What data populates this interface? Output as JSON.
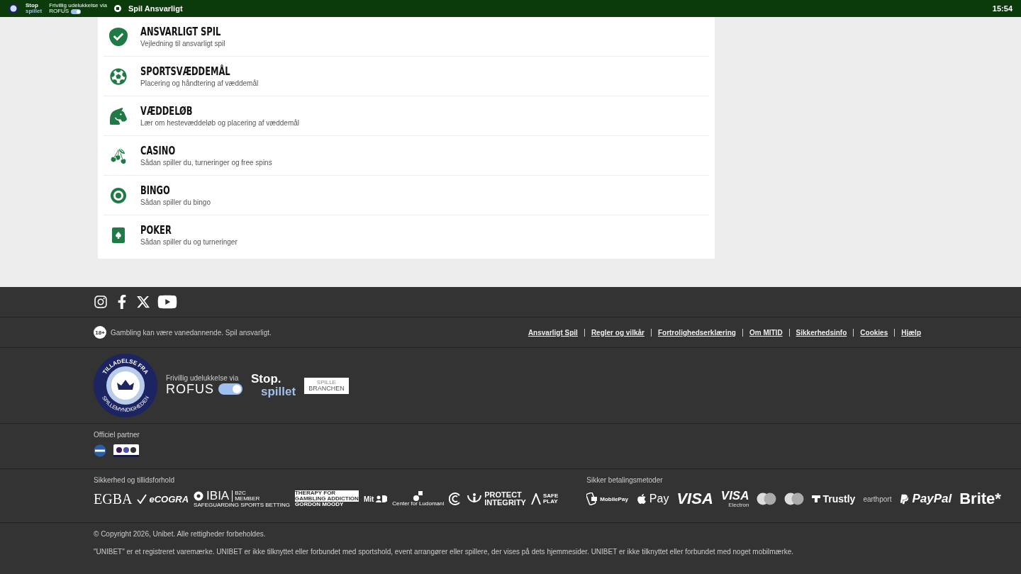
{
  "top_bar": {
    "stop_logo": [
      "Stop",
      "spillet"
    ],
    "rofus_caption": "Frivillig udelukkelse via",
    "rofus_word": "ROFUS",
    "title": "Spil Ansvarligt",
    "time": "15:54"
  },
  "menu": [
    {
      "kind": "shield",
      "title": "ANSVARLIGT SPIL",
      "subtitle": "Vejledning til ansvarligt spil"
    },
    {
      "kind": "ball",
      "title": "SPORTSVÆDDEMÅL",
      "subtitle": "Placering og håndtering af væddemål"
    },
    {
      "kind": "horse",
      "title": "VÆDDELØB",
      "subtitle": "Lær om hestevæddeløb og placering af væddemål"
    },
    {
      "kind": "cherries",
      "title": "CASINO",
      "subtitle": "Sådan spiller du, turneringer og free spins"
    },
    {
      "kind": "bingo",
      "title": "BINGO",
      "subtitle": "Sådan spiller du bingo"
    },
    {
      "kind": "card",
      "title": "POKER",
      "subtitle": "Sådan spiller du og turneringer"
    }
  ],
  "footer": {
    "social": [
      {
        "kind": "instagram"
      },
      {
        "kind": "facebook"
      },
      {
        "kind": "x"
      },
      {
        "kind": "youtube"
      }
    ],
    "age_badge": "18+",
    "warning": "Gambling kan være vanedannende. Spil ansvarligt.",
    "links": [
      "Ansvarligt Spil",
      "Regler og vilkår",
      "Fortrolighedserklæring",
      "Om MITID",
      "Sikkerhedsinfo",
      "Cookies",
      "Hjælp"
    ],
    "license_seal": {
      "top": "TILLADELSE FRA",
      "bottom": "SPILLEMYNDIGHEDEN"
    },
    "rofus": {
      "caption": "Frivillig udelukkelse via",
      "word": "ROFUS"
    },
    "stop_logo": [
      "Stop.",
      "spillet"
    ],
    "branchen_logo": [
      "SPILLE",
      "BRANCHEN"
    ],
    "partner_heading": "Officiel partner",
    "security_heading": "Sikkerhed og tillidsforhold",
    "security_logos": [
      {
        "kind": "egba",
        "texts": [
          "EGBA"
        ]
      },
      {
        "kind": "ecogra",
        "texts": [
          "eCOGRA"
        ]
      },
      {
        "kind": "ibia",
        "texts": [
          "IBIA",
          "B2C MEMBER",
          "SAFEGUARDING SPORTS BETTING"
        ]
      },
      {
        "kind": "gordon",
        "texts": [
          "THERAPY FOR",
          "GAMBLING ADDICTION",
          "GORDON MOODY"
        ]
      },
      {
        "kind": "mitid",
        "texts": [
          "Mit"
        ]
      },
      {
        "kind": "ludomani",
        "texts": [
          "Center for Ludomani"
        ]
      },
      {
        "kind": "cc"
      },
      {
        "kind": "protect",
        "texts": [
          "PROTECT",
          "INTEGRITY"
        ]
      },
      {
        "kind": "safeplay",
        "texts": [
          "SAFE",
          "PLAY"
        ]
      }
    ],
    "payment_heading": "Sikker betalingsmetoder",
    "payment_logos": [
      {
        "kind": "mobilepay",
        "texts": [
          "MobilePay"
        ]
      },
      {
        "kind": "applepay",
        "texts": [
          "Pay"
        ]
      },
      {
        "kind": "visa",
        "texts": [
          "VISA"
        ]
      },
      {
        "kind": "visa-electron",
        "texts": [
          "VISA",
          "Electron"
        ]
      },
      {
        "kind": "mastercard"
      },
      {
        "kind": "maestro"
      },
      {
        "kind": "trustly",
        "texts": [
          "Trustly"
        ]
      },
      {
        "kind": "earthport",
        "texts": [
          "earthport"
        ]
      },
      {
        "kind": "paypal",
        "texts": [
          "PayPal"
        ]
      },
      {
        "kind": "brite",
        "texts": [
          "Brite*"
        ]
      }
    ],
    "copyright": "© Copyright 2026, Unibet. Alle rettigheder forbeholdes.",
    "trademark": "\"UNIBET\" er et registreret varemærke. UNIBET er ikke tilknyttet eller forbundet med sportshold, event arrangører eller spillere, der vises på dets hjemmesider. UNIBET er ikke tilknyttet eller forbundet med noget mobilmærke."
  }
}
